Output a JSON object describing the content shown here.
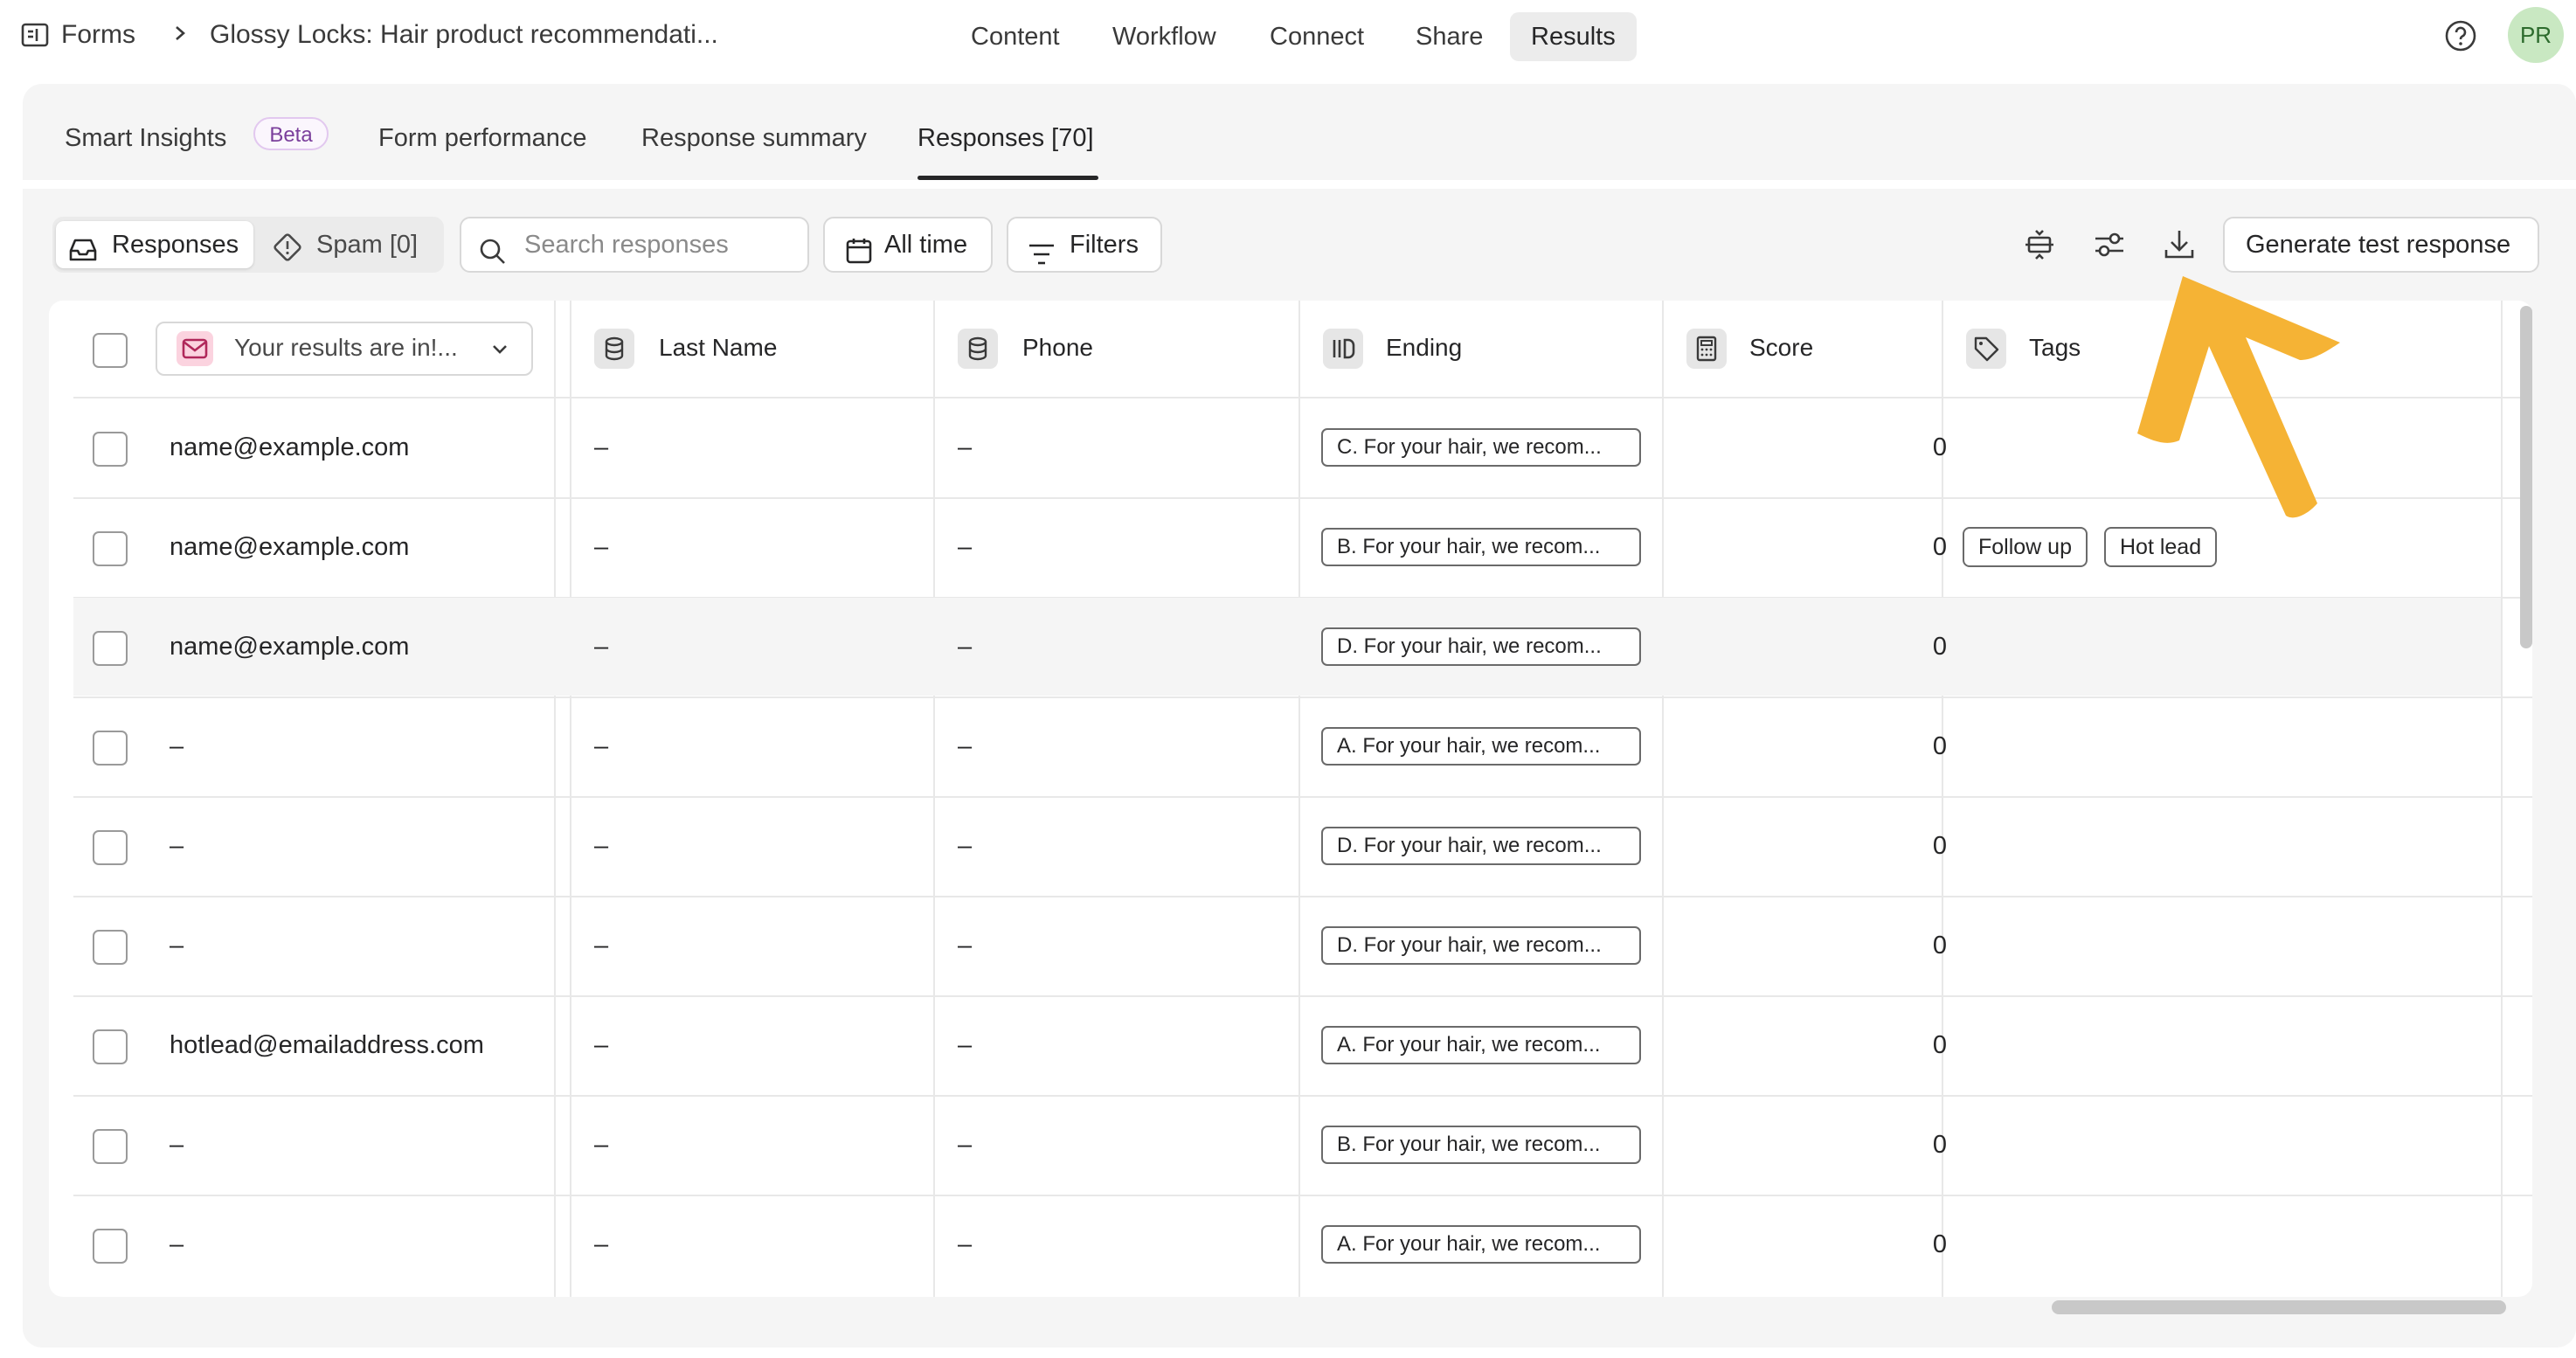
{
  "breadcrumb": {
    "root": "Forms",
    "separator": ">",
    "form_title": "Glossy Locks: Hair product recommendati..."
  },
  "nav": {
    "items": [
      "Content",
      "Workflow",
      "Connect",
      "Share",
      "Results"
    ],
    "active": "Results"
  },
  "user": {
    "initials": "PR"
  },
  "subtabs": {
    "smart_insights": "Smart Insights",
    "beta_badge": "Beta",
    "form_performance": "Form performance",
    "response_summary": "Response summary",
    "responses": "Responses [70]"
  },
  "toolbar": {
    "responses_label": "Responses",
    "spam_label": "Spam [0]",
    "search_placeholder": "Search responses",
    "date_filter": "All time",
    "filters_label": "Filters",
    "generate_label": "Generate test response"
  },
  "table": {
    "columns": {
      "first": "Your results are in!...",
      "last_name": "Last Name",
      "phone": "Phone",
      "ending": "Ending",
      "score": "Score",
      "tags": "Tags"
    },
    "rows": [
      {
        "email": "name@example.com",
        "last_name": "–",
        "phone": "–",
        "ending": "C. For your hair, we recom...",
        "score": "0",
        "tags": []
      },
      {
        "email": "name@example.com",
        "last_name": "–",
        "phone": "–",
        "ending": "B. For your hair, we recom...",
        "score": "0",
        "tags": [
          "Follow up",
          "Hot lead"
        ]
      },
      {
        "email": "name@example.com",
        "last_name": "–",
        "phone": "–",
        "ending": "D. For your hair, we recom...",
        "score": "0",
        "tags": []
      },
      {
        "email": "–",
        "last_name": "–",
        "phone": "–",
        "ending": "A. For your hair, we recom...",
        "score": "0",
        "tags": []
      },
      {
        "email": "–",
        "last_name": "–",
        "phone": "–",
        "ending": "D. For your hair, we recom...",
        "score": "0",
        "tags": []
      },
      {
        "email": "–",
        "last_name": "–",
        "phone": "–",
        "ending": "D. For your hair, we recom...",
        "score": "0",
        "tags": []
      },
      {
        "email": "hotlead@emailaddress.com",
        "last_name": "–",
        "phone": "–",
        "ending": "A. For your hair, we recom...",
        "score": "0",
        "tags": []
      },
      {
        "email": "–",
        "last_name": "–",
        "phone": "–",
        "ending": "B. For your hair, we recom...",
        "score": "0",
        "tags": []
      },
      {
        "email": "–",
        "last_name": "–",
        "phone": "–",
        "ending": "A. For your hair, we recom...",
        "score": "0",
        "tags": []
      }
    ]
  },
  "colors": {
    "accent_arrow": "#f5b335",
    "avatar_bg": "#c9e8c2",
    "beta_border": "#e2c8ef",
    "email_icon_bg": "#fbd3df"
  }
}
